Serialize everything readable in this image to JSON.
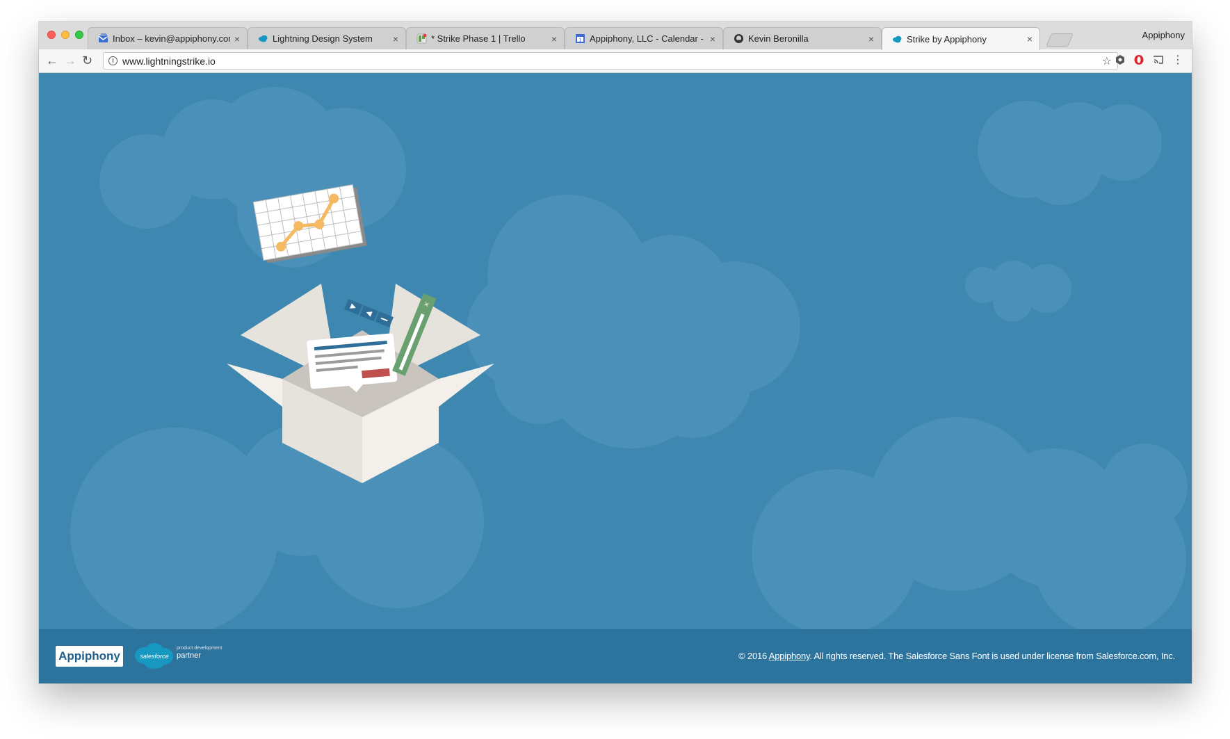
{
  "browser": {
    "tabs": [
      {
        "title": "Inbox – kevin@appiphony.com",
        "favicon": "inbox-icon",
        "active": false
      },
      {
        "title": "Lightning Design System",
        "favicon": "salesforce-cloud-icon",
        "active": false
      },
      {
        "title": "* Strike Phase 1 | Trello",
        "favicon": "trello-icon",
        "active": false
      },
      {
        "title": "Appiphony, LLC - Calendar - W",
        "favicon": "calendar-icon",
        "active": false
      },
      {
        "title": "Kevin Beronilla",
        "favicon": "github-icon",
        "active": false
      },
      {
        "title": "Strike by Appiphony",
        "favicon": "salesforce-cloud-icon",
        "active": true
      }
    ],
    "close_glyph": "×",
    "profile_name": "Appiphony",
    "url": "www.lightningstrike.io",
    "info_glyph": "i",
    "star_glyph": "☆",
    "back_glyph": "←",
    "forward_glyph": "→",
    "reload_glyph": "↻",
    "menu_glyph": "⋮"
  },
  "footer": {
    "logo_text": "Appiphony",
    "salesforce_logo_text": "salesforce",
    "partner_small": "product development",
    "partner_big": "partner",
    "copyright_prefix": "© 2016 ",
    "copyright_link": "Appiphony",
    "copyright_suffix": ". All rights reserved. The Salesforce Sans Font is used under license from Salesforce.com, Inc."
  },
  "colors": {
    "page_background": "#3d87b0",
    "footer_background": "#2c739e",
    "cloud": "#4a90b8",
    "chart_line": "#f5b961",
    "pencil": "#6a9f6f"
  }
}
